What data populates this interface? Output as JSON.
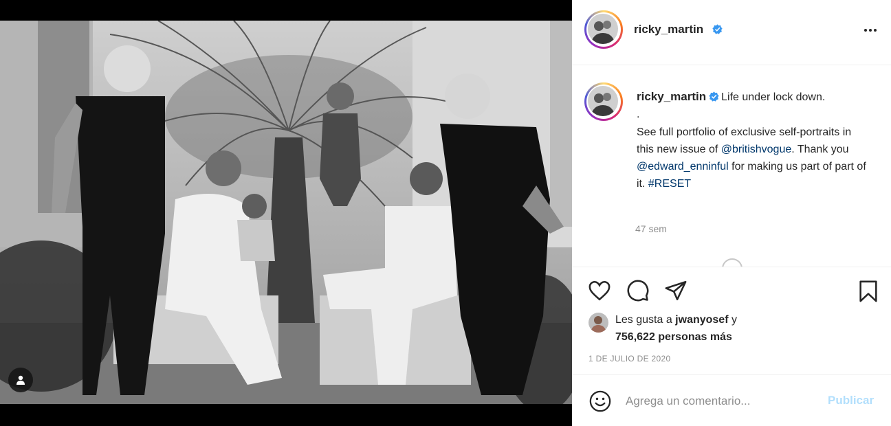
{
  "post": {
    "username": "ricky_martin",
    "caption_lead": "Life under lock down.",
    "caption_dot": ".",
    "caption_body_1": "See full portfolio of exclusive self-portraits in this new issue of",
    "mention_1": "@britishvogue",
    "caption_body_2": ". Thank you",
    "mention_2": "@edward_enninful",
    "caption_body_3": " for making us part of part of it.",
    "hashtag": "#RESET",
    "age": "47 sem"
  },
  "likes": {
    "prefix": "Les gusta a ",
    "user": "jwanyosef",
    "connector": " y",
    "count_text": "756,622 personas más"
  },
  "date": "1 DE JULIO DE 2020",
  "comment": {
    "placeholder": "Agrega un comentario...",
    "publish_label": "Publicar"
  },
  "icons": {
    "verified": "verified-badge-icon",
    "more": "more-options-icon",
    "like": "heart-icon",
    "comment": "comment-bubble-icon",
    "share": "paper-plane-icon",
    "save": "bookmark-icon",
    "emoji": "smiley-icon",
    "tag": "user-tag-icon"
  },
  "colors": {
    "verified": "#3897f0",
    "link": "#00376b",
    "muted": "#8e8e8e",
    "publish_disabled": "#b2dffc"
  }
}
